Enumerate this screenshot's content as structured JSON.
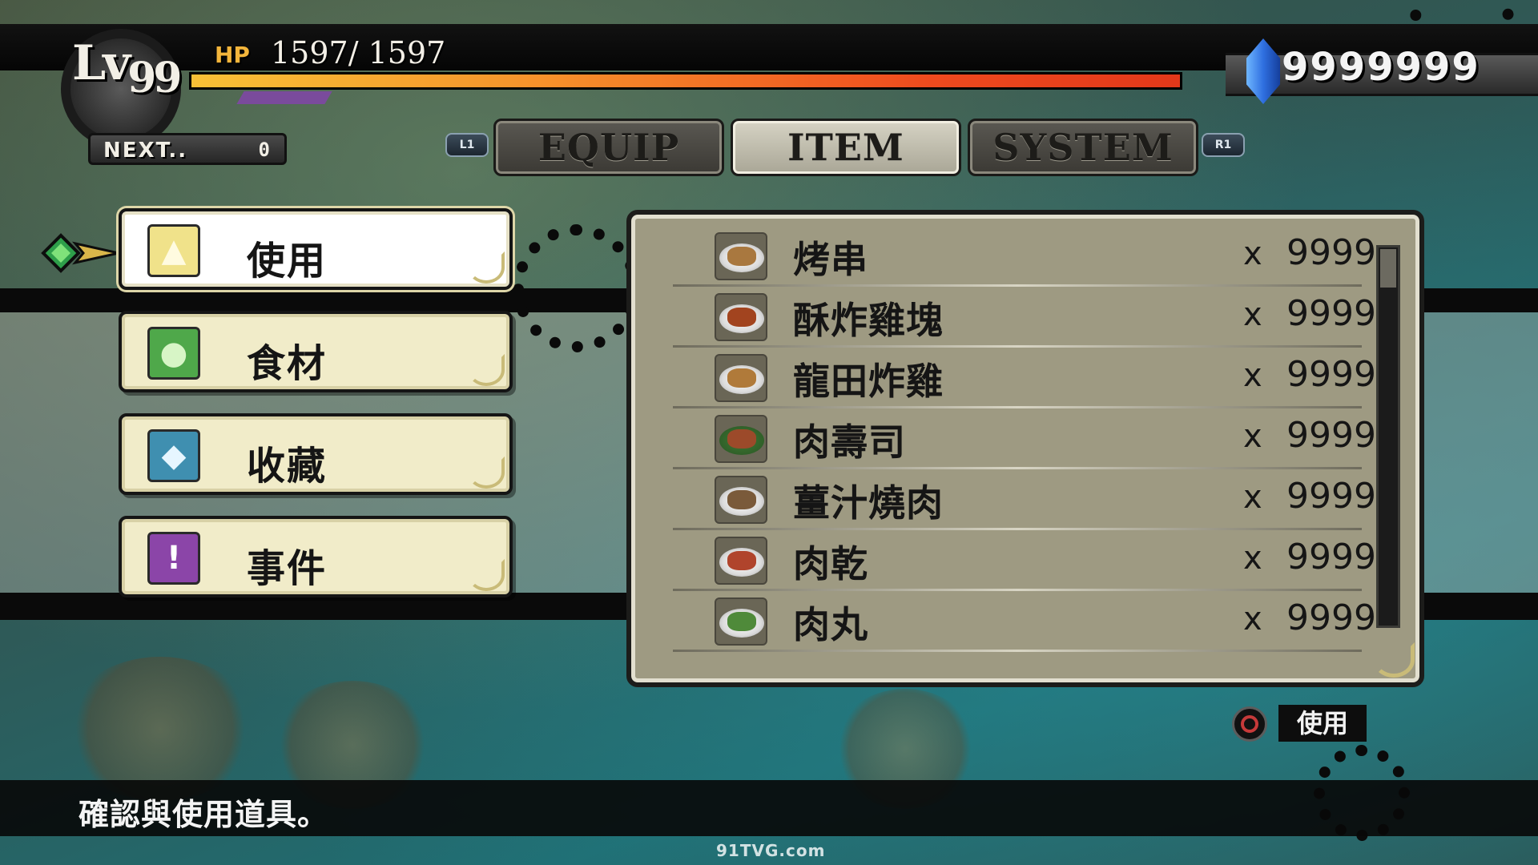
{
  "player": {
    "level_prefix": "Lv",
    "level": "99",
    "hp_label": "HP",
    "hp_text": "1597/ 1597",
    "hp_fraction": 1.0,
    "next_label": "NEXT..",
    "next_value": "0"
  },
  "currency": {
    "icon": "blue-crystal-icon",
    "value": "9999999"
  },
  "tabs": {
    "left_shoulder": "L1",
    "right_shoulder": "R1",
    "items": [
      {
        "label": "EQUIP",
        "active": false
      },
      {
        "label": "ITEM",
        "active": true
      },
      {
        "label": "SYSTEM",
        "active": false
      }
    ]
  },
  "categories": [
    {
      "label": "使用",
      "icon": "potion-icon",
      "color": "#f0e28a",
      "selected": true
    },
    {
      "label": "食材",
      "icon": "apple-icon",
      "color": "#4fa84a",
      "selected": false
    },
    {
      "label": "收藏",
      "icon": "gem-icon",
      "color": "#3f8fb0",
      "selected": false
    },
    {
      "label": "事件",
      "icon": "exclamation-icon",
      "color": "#8b45a8",
      "selected": false
    }
  ],
  "items": [
    {
      "name": "烤串",
      "x": "x",
      "qty": "9999",
      "food_color": "#a9783f"
    },
    {
      "name": "酥炸雞塊",
      "x": "x",
      "qty": "9999",
      "food_color": "#a2441f"
    },
    {
      "name": "龍田炸雞",
      "x": "x",
      "qty": "9999",
      "food_color": "#b07a3a"
    },
    {
      "name": "肉壽司",
      "x": "x",
      "qty": "9999",
      "food_color": "#9c4a2a"
    },
    {
      "name": "薑汁燒肉",
      "x": "x",
      "qty": "9999",
      "food_color": "#7a5a3a"
    },
    {
      "name": "肉乾",
      "x": "x",
      "qty": "9999",
      "food_color": "#b0442c"
    },
    {
      "name": "肉丸",
      "x": "x",
      "qty": "9999",
      "food_color": "#4f8a3a"
    }
  ],
  "scroll_position": 0.0,
  "prompt": {
    "button_icon": "circle-button-icon",
    "label": "使用"
  },
  "help_text": "確認與使用道具。",
  "watermark": "91TVG.com"
}
